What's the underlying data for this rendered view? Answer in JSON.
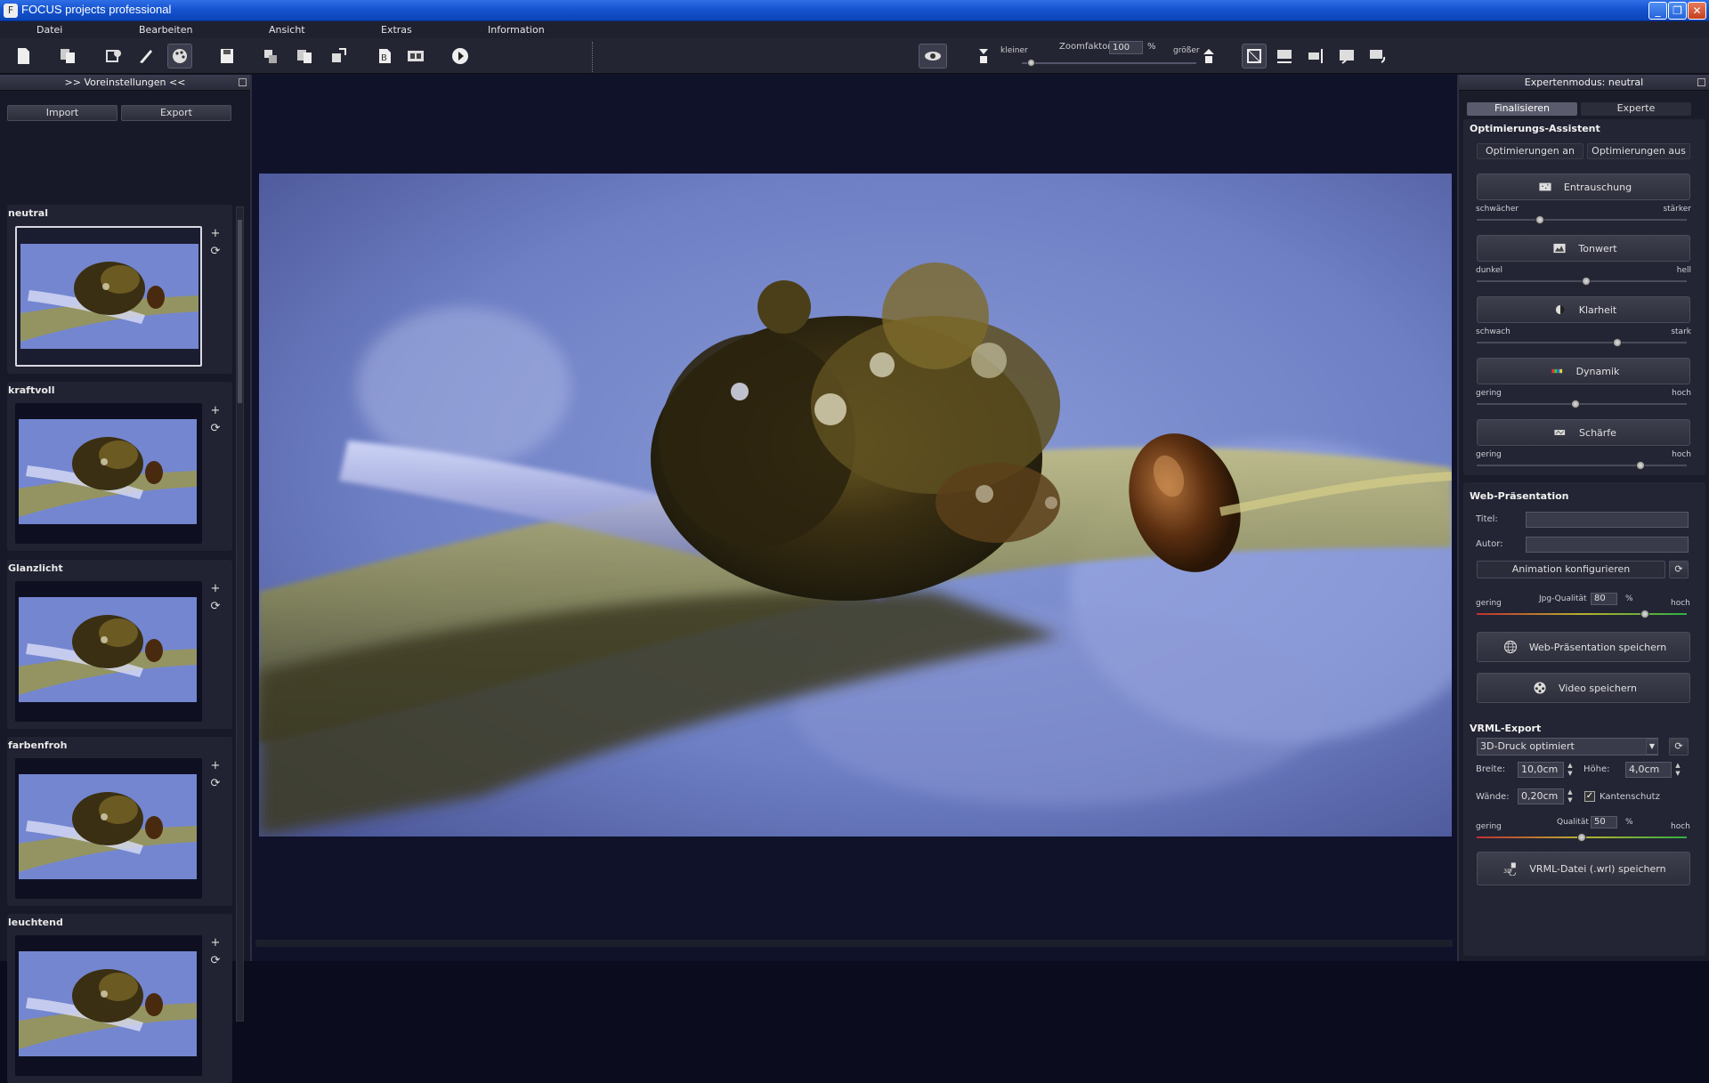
{
  "window": {
    "title": "FOCUS projects professional",
    "controls": {
      "minimize": "_",
      "maximize": "❐",
      "close": "✕"
    }
  },
  "menu": [
    "Datei",
    "Bearbeiten",
    "Ansicht",
    "Extras",
    "Information"
  ],
  "toolbar": {
    "icons": [
      "new-document-icon",
      "copy-icon",
      "settings-icon",
      "brush-icon",
      "palette-icon",
      "save-icon",
      "export-icon",
      "layers-icon",
      "share-icon",
      "bold-export-icon",
      "filmstrip-icon",
      "play-icon"
    ],
    "eye_icon": "eye-icon",
    "zoom": {
      "smaller_label": "kleiner",
      "label": "Zoomfaktor",
      "value": "100",
      "unit": "%",
      "larger_label": "größer",
      "level_fraction": 0.05
    },
    "view_icons": [
      "fit-icon",
      "width-icon",
      "height-icon",
      "window-icon",
      "rotate-icon"
    ]
  },
  "left_panel": {
    "header": ">> Voreinstellungen <<",
    "import_label": "Import",
    "export_label": "Export",
    "presets": [
      {
        "name": "neutral",
        "selected": true
      },
      {
        "name": "kraftvoll",
        "selected": false
      },
      {
        "name": "Glanzlicht",
        "selected": false
      },
      {
        "name": "farbenfroh",
        "selected": false
      },
      {
        "name": "leuchtend",
        "selected": false
      }
    ],
    "add_symbol": "+",
    "apply_symbol": "⟳"
  },
  "right_panel": {
    "header": "Expertenmodus: neutral",
    "tabs": [
      "Finalisieren",
      "Experte"
    ],
    "optimizer": {
      "title": "Optimierungs-Assistent",
      "on_label": "Optimierungen an",
      "off_label": "Optimierungen aus",
      "controls": [
        {
          "label": "Entrauschung",
          "icon": "noise-icon",
          "min": "schwächer",
          "max": "stärker",
          "value": 0.3
        },
        {
          "label": "Tonwert",
          "icon": "histogram-icon",
          "min": "dunkel",
          "max": "hell",
          "value": 0.52
        },
        {
          "label": "Klarheit",
          "icon": "contrast-icon",
          "min": "schwach",
          "max": "stark",
          "value": 0.67
        },
        {
          "label": "Dynamik",
          "icon": "color-bars-icon",
          "min": "gering",
          "max": "hoch",
          "value": 0.47
        },
        {
          "label": "Schärfe",
          "icon": "sharpen-icon",
          "min": "gering",
          "max": "hoch",
          "value": 0.78
        }
      ]
    },
    "web": {
      "title": "Web-Präsentation",
      "title_label": "Titel:",
      "title_value": "",
      "author_label": "Autor:",
      "author_value": "",
      "animation_label": "Animation konfigurieren",
      "quality_min": "gering",
      "quality_label": "Jpg-Qualität",
      "quality_value": "80",
      "quality_unit": "%",
      "quality_max": "hoch",
      "quality_fraction": 0.8,
      "save_web_label": "Web-Präsentation speichern",
      "save_video_label": "Video speichern"
    },
    "vrml": {
      "title": "VRML-Export",
      "mode_value": "3D-Druck optimiert",
      "width_label": "Breite:",
      "width_value": "10,0cm",
      "height_label": "Höhe:",
      "height_value": "4,0cm",
      "walls_label": "Wände:",
      "walls_value": "0,20cm",
      "edge_label": "Kantenschutz",
      "edge_checked": true,
      "quality_min": "gering",
      "quality_label": "Qualität",
      "quality_value": "50",
      "quality_unit": "%",
      "quality_max": "hoch",
      "quality_fraction": 0.5,
      "save_label": "VRML-Datei (.wrl) speichern"
    }
  }
}
